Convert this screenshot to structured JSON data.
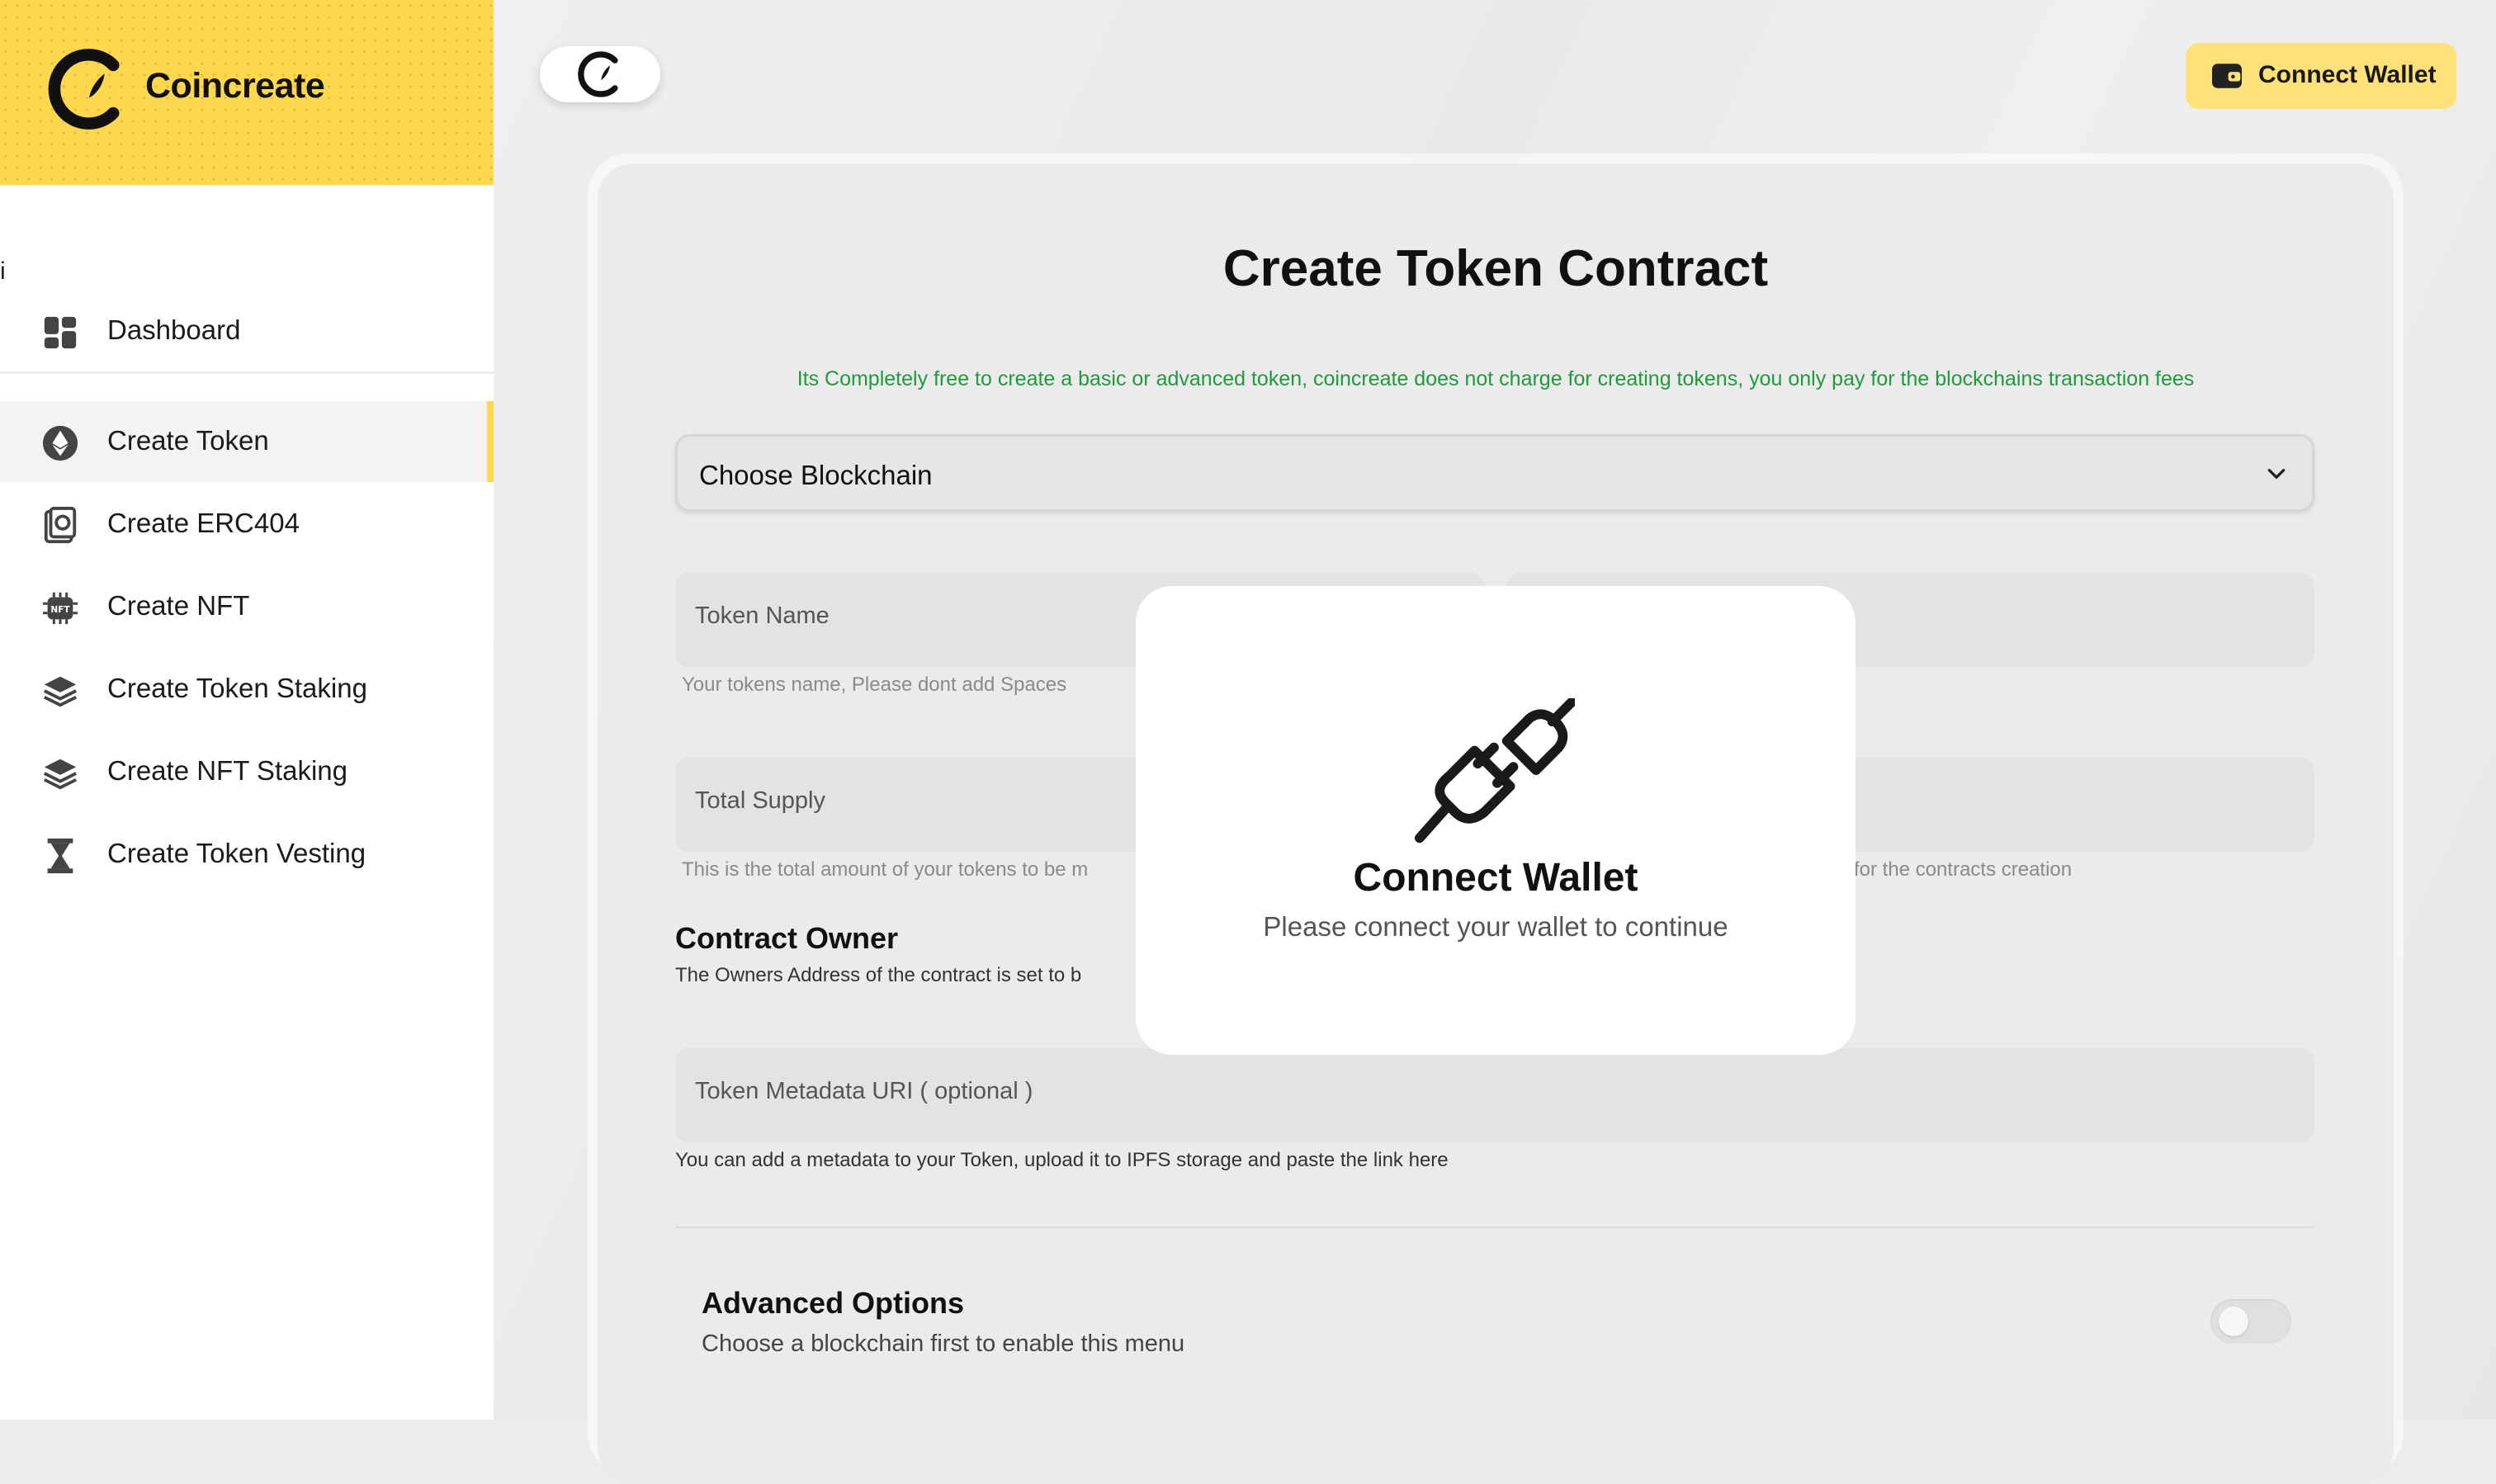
{
  "app": {
    "name": "Coincreate"
  },
  "sidebar": {
    "stray_char": "i",
    "items": [
      {
        "label": "Dashboard",
        "icon": "dashboard-icon"
      },
      {
        "label": "Create Token",
        "icon": "ethereum-icon",
        "active": true
      },
      {
        "label": "Create ERC404",
        "icon": "erc404-icon"
      },
      {
        "label": "Create NFT",
        "icon": "nft-chip-icon"
      },
      {
        "label": "Create Token Staking",
        "icon": "layers-icon"
      },
      {
        "label": "Create NFT Staking",
        "icon": "layers-icon"
      },
      {
        "label": "Create Token Vesting",
        "icon": "hourglass-icon"
      }
    ]
  },
  "header": {
    "connect_wallet_label": "Connect Wallet"
  },
  "form": {
    "title": "Create Token Contract",
    "notice": "Its Completely free to create a basic or advanced token, coincreate does not charge for creating tokens, you only pay for the blockchains transaction fees",
    "blockchain_select": {
      "value": "Choose Blockchain"
    },
    "token_name": {
      "placeholder": "Token Name",
      "hint": "Your tokens name, Please dont add Spaces"
    },
    "total_supply": {
      "placeholder": "Total Supply",
      "hint_left": "This is the total amount of your tokens to be m",
      "hint_right": "for the contracts creation"
    },
    "contract_owner": {
      "title": "Contract Owner",
      "desc": "The Owners Address of the contract is set to b"
    },
    "metadata_uri": {
      "placeholder": "Token Metadata URI ( optional )",
      "hint": "You can add a metadata to your Token, upload it to IPFS storage and paste the link here"
    },
    "advanced": {
      "title": "Advanced Options",
      "subtitle": "Choose a blockchain first to enable this menu",
      "enabled": false
    }
  },
  "modal": {
    "title": "Connect Wallet",
    "subtitle": "Please connect your wallet to continue",
    "icon": "plug-disconnected-icon"
  },
  "colors": {
    "accent": "#ffd84d",
    "notice_green": "#1f9a3c",
    "button_yellow": "#ffe17a"
  }
}
